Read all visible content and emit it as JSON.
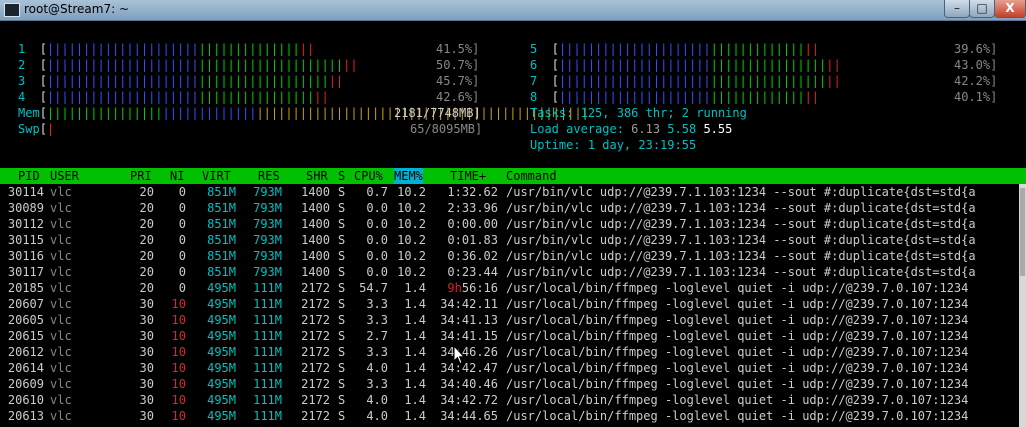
{
  "window": {
    "title": "root@Stream7: ~",
    "minimize_glyph": "–",
    "maximize_glyph": "□",
    "close_glyph": "X"
  },
  "meters": {
    "cpus_left": [
      {
        "id": "1",
        "blue": "|||||||||||||||||||||",
        "green": "||||||||||||||",
        "red": "||",
        "percent": "41.5%]"
      },
      {
        "id": "2",
        "blue": "|||||||||||||||||||||",
        "green": "||||||||||||||||||||",
        "red": "||",
        "percent": "50.7%]"
      },
      {
        "id": "3",
        "blue": "|||||||||||||||||||||",
        "green": "||||||||||||||||||",
        "red": "||",
        "percent": "45.7%]"
      },
      {
        "id": "4",
        "blue": "|||||||||||||||||||||",
        "green": "||||||||||||||||",
        "red": "||",
        "percent": "42.6%]"
      }
    ],
    "cpus_right": [
      {
        "id": "5",
        "blue": "|||||||||||||||||||||",
        "green": "|||||||||||||",
        "red": "||",
        "percent": "39.6%]"
      },
      {
        "id": "6",
        "blue": "|||||||||||||||||||||",
        "green": "||||||||||||||||",
        "red": "||",
        "percent": "43.0%]"
      },
      {
        "id": "7",
        "blue": "|||||||||||||||||||||",
        "green": "||||||||||||||||",
        "red": "||",
        "percent": "42.2%]"
      },
      {
        "id": "8",
        "blue": "|||||||||||||||||||||",
        "green": "|||||||||||||",
        "red": "||",
        "percent": "40.1%]"
      }
    ],
    "mem": {
      "label": "Mem",
      "green": "||||||||||||||||",
      "blue": "|||||||||||||",
      "yellow": "||||||||||||||||||||||||||||||||||||||||||||||",
      "value": "2181/7748MB]"
    },
    "swp": {
      "label": "Swp",
      "red": "|",
      "value": "65/8095MB]"
    },
    "open_bracket": "[",
    "tasks": {
      "label": "Tasks:",
      "value": "125,",
      "thr": "386",
      "thr_label": "thr;",
      "running": "2",
      "running_label": "running"
    },
    "load": {
      "label": "Load average:",
      "v1": "6.13",
      "v2": "5.58",
      "v3": "5.55"
    },
    "uptime": {
      "label": "Uptime:",
      "value": "1 day, 23:19:55"
    }
  },
  "process_table": {
    "columns": [
      "PID",
      "USER",
      "PRI",
      "NI",
      "VIRT",
      "RES",
      "SHR",
      "S",
      "CPU%",
      "MEM%",
      "TIME+",
      "Command"
    ],
    "sorted_column": "MEM%",
    "rows": [
      [
        "30114",
        "vlc",
        "20",
        "0",
        "851M",
        "793M",
        "1400",
        "S",
        "0.7",
        "10.2",
        "1:32.62",
        "/usr/bin/vlc udp://@239.7.1.103:1234 --sout #:duplicate{dst=std{a"
      ],
      [
        "30089",
        "vlc",
        "20",
        "0",
        "851M",
        "793M",
        "1400",
        "S",
        "0.0",
        "10.2",
        "2:33.96",
        "/usr/bin/vlc udp://@239.7.1.103:1234 --sout #:duplicate{dst=std{a"
      ],
      [
        "30112",
        "vlc",
        "20",
        "0",
        "851M",
        "793M",
        "1400",
        "S",
        "0.0",
        "10.2",
        "0:00.00",
        "/usr/bin/vlc udp://@239.7.1.103:1234 --sout #:duplicate{dst=std{a"
      ],
      [
        "30115",
        "vlc",
        "20",
        "0",
        "851M",
        "793M",
        "1400",
        "S",
        "0.0",
        "10.2",
        "0:01.83",
        "/usr/bin/vlc udp://@239.7.1.103:1234 --sout #:duplicate{dst=std{a"
      ],
      [
        "30116",
        "vlc",
        "20",
        "0",
        "851M",
        "793M",
        "1400",
        "S",
        "0.0",
        "10.2",
        "0:36.02",
        "/usr/bin/vlc udp://@239.7.1.103:1234 --sout #:duplicate{dst=std{a"
      ],
      [
        "30117",
        "vlc",
        "20",
        "0",
        "851M",
        "793M",
        "1400",
        "S",
        "0.0",
        "10.2",
        "0:23.44",
        "/usr/bin/vlc udp://@239.7.1.103:1234 --sout #:duplicate{dst=std{a"
      ],
      [
        "20185",
        "vlc",
        "20",
        "0",
        "495M",
        "111M",
        "2172",
        "S",
        "54.7",
        "1.4",
        "9h56:16",
        "/usr/local/bin/ffmpeg -loglevel quiet -i udp://@239.7.0.107:1234"
      ],
      [
        "20607",
        "vlc",
        "30",
        "10",
        "495M",
        "111M",
        "2172",
        "S",
        "3.3",
        "1.4",
        "34:42.11",
        "/usr/local/bin/ffmpeg -loglevel quiet -i udp://@239.7.0.107:1234"
      ],
      [
        "20605",
        "vlc",
        "30",
        "10",
        "495M",
        "111M",
        "2172",
        "S",
        "3.3",
        "1.4",
        "34:41.13",
        "/usr/local/bin/ffmpeg -loglevel quiet -i udp://@239.7.0.107:1234"
      ],
      [
        "20615",
        "vlc",
        "30",
        "10",
        "495M",
        "111M",
        "2172",
        "S",
        "2.7",
        "1.4",
        "34:41.15",
        "/usr/local/bin/ffmpeg -loglevel quiet -i udp://@239.7.0.107:1234"
      ],
      [
        "20612",
        "vlc",
        "30",
        "10",
        "495M",
        "111M",
        "2172",
        "S",
        "3.3",
        "1.4",
        "34:46.26",
        "/usr/local/bin/ffmpeg -loglevel quiet -i udp://@239.7.0.107:1234"
      ],
      [
        "20614",
        "vlc",
        "30",
        "10",
        "495M",
        "111M",
        "2172",
        "S",
        "4.0",
        "1.4",
        "34:42.47",
        "/usr/local/bin/ffmpeg -loglevel quiet -i udp://@239.7.0.107:1234"
      ],
      [
        "20609",
        "vlc",
        "30",
        "10",
        "495M",
        "111M",
        "2172",
        "S",
        "3.3",
        "1.4",
        "34:40.46",
        "/usr/local/bin/ffmpeg -loglevel quiet -i udp://@239.7.0.107:1234"
      ],
      [
        "20610",
        "vlc",
        "30",
        "10",
        "495M",
        "111M",
        "2172",
        "S",
        "4.0",
        "1.4",
        "34:42.72",
        "/usr/local/bin/ffmpeg -loglevel quiet -i udp://@239.7.0.107:1234"
      ],
      [
        "20613",
        "vlc",
        "30",
        "10",
        "495M",
        "111M",
        "2172",
        "S",
        "4.0",
        "1.4",
        "34:44.65",
        "/usr/local/bin/ffmpeg -loglevel quiet -i udp://@239.7.0.107:1234"
      ]
    ]
  },
  "colors": {
    "header_bg": "#00c000",
    "sorted_bg": "#00b0d0",
    "cyan": "#00c0c0",
    "red": "#dd2222"
  }
}
